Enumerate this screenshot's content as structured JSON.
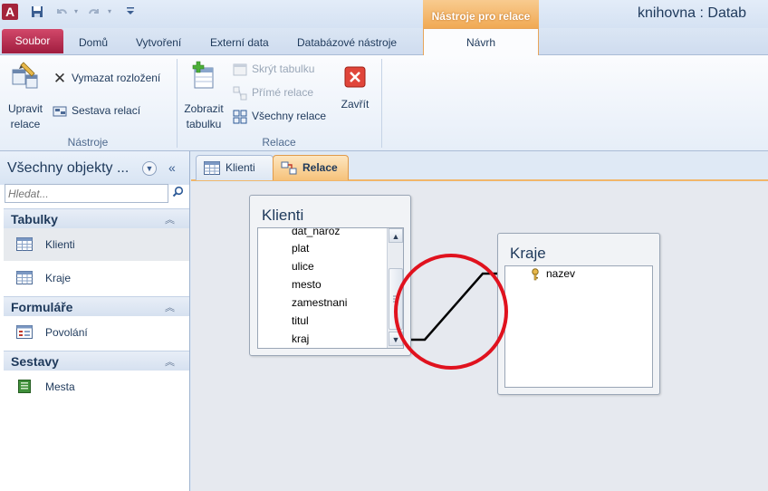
{
  "titlebar": {
    "app_icon": "A",
    "title": "knihovna : Datab",
    "context_tab_header": "Nástroje pro relace",
    "qat": [
      "save-icon",
      "undo-icon",
      "redo-icon",
      "customize-icon"
    ]
  },
  "tabs": {
    "file": "Soubor",
    "items": [
      "Domů",
      "Vytvoření",
      "Externí data",
      "Databázové nástroje"
    ],
    "active": "Návrh"
  },
  "ribbon": {
    "groups": {
      "tools": {
        "label": "Nástroje",
        "edit_relationships": [
          "Upravit",
          "relace"
        ],
        "clear_layout": "Vymazat rozložení",
        "relationship_report": "Sestava relací"
      },
      "relationships": {
        "label": "Relace",
        "show_table": [
          "Zobrazit",
          "tabulku"
        ],
        "hide_table": "Skrýt tabulku",
        "direct_relationships": "Přímé relace",
        "all_relationships": "Všechny relace",
        "close": "Zavřít"
      }
    }
  },
  "nav": {
    "title": "Všechny objekty ...",
    "search_placeholder": "Hledat...",
    "groups": [
      {
        "label": "Tabulky",
        "items": [
          {
            "label": "Klienti",
            "selected": true,
            "icon": "table-icon"
          },
          {
            "label": "Kraje",
            "selected": false,
            "icon": "table-icon"
          }
        ]
      },
      {
        "label": "Formuláře",
        "items": [
          {
            "label": "Povolání",
            "selected": false,
            "icon": "form-icon"
          }
        ]
      },
      {
        "label": "Sestavy",
        "items": [
          {
            "label": "Mesta",
            "selected": false,
            "icon": "report-icon"
          }
        ]
      }
    ]
  },
  "doc_tabs": {
    "tabs": [
      {
        "label": "Klienti",
        "icon": "table-icon",
        "active": false
      },
      {
        "label": "Relace",
        "icon": "relationship-icon",
        "active": true
      }
    ]
  },
  "diagram": {
    "tables": [
      {
        "title": "Klienti",
        "fields": [
          "dat_naroz",
          "plat",
          "ulice",
          "mesto",
          "zamestnani",
          "titul",
          "kraj"
        ],
        "has_scrollbar": true
      },
      {
        "title": "Kraje",
        "fields": [
          "nazev"
        ],
        "primary_key": "nazev",
        "has_scrollbar": false
      }
    ],
    "relationship": {
      "from_table": "Klienti",
      "from_field": "kraj",
      "to_table": "Kraje",
      "to_field": "nazev",
      "highlight_color": "#e0121e"
    }
  },
  "colors": {
    "file_tab": "#b3254a",
    "context_tab": "#f3b061",
    "accent": "#1e395b"
  }
}
